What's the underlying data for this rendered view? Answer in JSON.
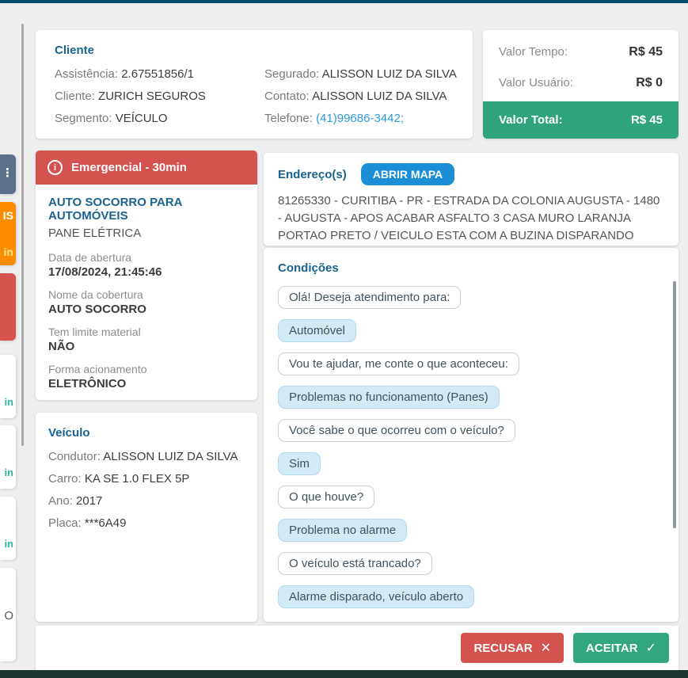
{
  "colors": {
    "top_bar": "#0c4d6c",
    "bottom_bar": "#1d3634",
    "title_blue": "#1a6390",
    "accent_red": "#d4534f",
    "accent_green": "#2fa37c",
    "accent_orange": "#fb8c00",
    "accent_slate": "#5c7089",
    "map_button_blue": "#1b8ed6",
    "link_blue": "#2d9cdb",
    "answer_bubble": "#d2e9f6",
    "teal_minutes": "#2bb5a0"
  },
  "left_rail": {
    "slate_glyph": "⋮",
    "orange_top": "IS",
    "orange_bottom": "in",
    "white1_min": "in",
    "white2_min": "in",
    "white3_min": "in",
    "white4_text": "O"
  },
  "client_card": {
    "title": "Cliente",
    "fields_left": [
      {
        "label": "Assistência:",
        "value": "2.67551856/1"
      },
      {
        "label": "Cliente:",
        "value": "ZURICH SEGUROS"
      },
      {
        "label": "Segmento:",
        "value": "VEÍCULO"
      }
    ],
    "fields_right": [
      {
        "label": "Segurado:",
        "value": "ALISSON LUIZ DA SILVA"
      },
      {
        "label": "Contato:",
        "value": "ALISSON LUIZ DA SILVA"
      },
      {
        "label": "Telefone:",
        "value": "(41)99686-3442;"
      }
    ]
  },
  "value_card": {
    "rows": [
      {
        "label": "Valor Tempo:",
        "value": "R$ 45"
      },
      {
        "label": "Valor Usuário:",
        "value": "R$ 0"
      }
    ],
    "total": {
      "label": "Valor Total:",
      "value": "R$ 45"
    }
  },
  "service_card": {
    "banner": {
      "icon": "i",
      "label": "Emergencial - 30min"
    },
    "service_name": "AUTO SOCORRO PARA AUTOMÓVEIS",
    "problem": "PANE ELÉTRICA",
    "fields": [
      {
        "label": "Data de abertura",
        "value": "17/08/2024, 21:45:46"
      },
      {
        "label": "Nome da cobertura",
        "value": "AUTO SOCORRO"
      },
      {
        "label": "Tem limite material",
        "value": "NÃO"
      },
      {
        "label": "Forma acionamento",
        "value": "ELETRÔNICO"
      }
    ]
  },
  "vehicle_card": {
    "title": "Veículo",
    "fields": [
      {
        "label": "Condutor:",
        "value": "ALISSON LUIZ DA SILVA"
      },
      {
        "label": "Carro:",
        "value": "KA SE 1.0 FLEX 5P"
      },
      {
        "label": "Ano:",
        "value": "2017"
      },
      {
        "label": "Placa:",
        "value": "***6A49"
      }
    ]
  },
  "address_card": {
    "title": "Endereço(s)",
    "map_button": "ABRIR MAPA",
    "text": "81265330 - CURITIBA - PR - ESTRADA DA COLONIA AUGUSTA - 1480 - AUGUSTA - APOS ACABAR ASFALTO 3 CASA MURO LARANJA PORTAO PRETO / VEICULO ESTA COM A BUZINA DISPARANDO"
  },
  "chat_card": {
    "title": "Condições",
    "messages": [
      {
        "type": "question",
        "text": "Olá! Deseja atendimento para:"
      },
      {
        "type": "answer",
        "text": "Automóvel"
      },
      {
        "type": "question",
        "text": "Vou te ajudar, me conte o que aconteceu:"
      },
      {
        "type": "answer",
        "text": "Problemas no funcionamento (Panes)"
      },
      {
        "type": "question",
        "text": "Você sabe o que ocorreu com o veículo?"
      },
      {
        "type": "answer",
        "text": "Sim"
      },
      {
        "type": "question",
        "text": "O que houve?"
      },
      {
        "type": "answer",
        "text": "Problema no alarme"
      },
      {
        "type": "question",
        "text": "O veículo está trancado?"
      },
      {
        "type": "answer",
        "text": "Alarme disparado, veículo aberto"
      }
    ]
  },
  "footer": {
    "recusar": "RECUSAR",
    "recusar_icon": "✕",
    "aceitar": "ACEITAR",
    "aceitar_icon": "✓"
  }
}
